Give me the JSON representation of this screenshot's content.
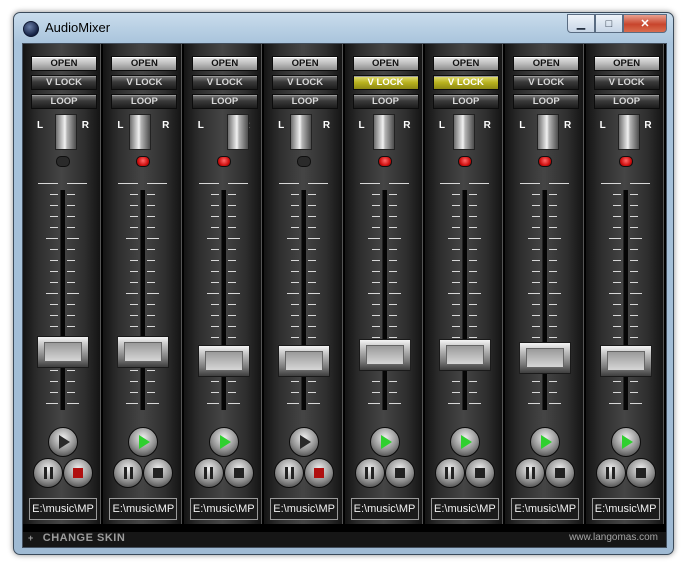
{
  "window": {
    "title": "AudioMixer",
    "minimize_glyph": "▁",
    "maximize_glyph": "□",
    "close_glyph": "✕"
  },
  "pan_labels": {
    "left": "L",
    "right": "R"
  },
  "channels": [
    {
      "open": "OPEN",
      "vlock": "V LOCK",
      "loop": "LOOP",
      "vlock_on": false,
      "pan_pos": 0.55,
      "led_on": false,
      "fader_level": 0.15,
      "playing": false,
      "stopped": true,
      "path": "E:\\music\\MP"
    },
    {
      "open": "OPEN",
      "vlock": "V LOCK",
      "loop": "LOOP",
      "vlock_on": false,
      "pan_pos": 0.38,
      "led_on": true,
      "fader_level": 0.15,
      "playing": true,
      "stopped": false,
      "path": "E:\\music\\MP"
    },
    {
      "open": "OPEN",
      "vlock": "V LOCK",
      "loop": "LOOP",
      "vlock_on": false,
      "pan_pos": 0.9,
      "led_on": true,
      "fader_level": 0.0,
      "playing": true,
      "stopped": false,
      "path": "E:\\music\\MP"
    },
    {
      "open": "OPEN",
      "vlock": "V LOCK",
      "loop": "LOOP",
      "vlock_on": false,
      "pan_pos": 0.38,
      "led_on": false,
      "fader_level": 0.0,
      "playing": false,
      "stopped": true,
      "path": "E:\\music\\MP"
    },
    {
      "open": "OPEN",
      "vlock": "V LOCK",
      "loop": "LOOP",
      "vlock_on": true,
      "pan_pos": 0.45,
      "led_on": true,
      "fader_level": 0.1,
      "playing": true,
      "stopped": false,
      "path": "E:\\music\\MP"
    },
    {
      "open": "OPEN",
      "vlock": "V LOCK",
      "loop": "LOOP",
      "vlock_on": true,
      "pan_pos": 0.45,
      "led_on": true,
      "fader_level": 0.1,
      "playing": true,
      "stopped": false,
      "path": "E:\\music\\MP"
    },
    {
      "open": "OPEN",
      "vlock": "V LOCK",
      "loop": "LOOP",
      "vlock_on": false,
      "pan_pos": 0.55,
      "led_on": true,
      "fader_level": 0.05,
      "playing": true,
      "stopped": false,
      "path": "E:\\music\\MP"
    },
    {
      "open": "OPEN",
      "vlock": "V LOCK",
      "loop": "LOOP",
      "vlock_on": false,
      "pan_pos": 0.55,
      "led_on": true,
      "fader_level": 0.0,
      "playing": true,
      "stopped": false,
      "path": "E:\\music\\MP"
    }
  ],
  "bottom": {
    "plus": "+",
    "change_skin": "CHANGE SKIN",
    "website": "www.langomas.com"
  },
  "colors": {
    "vlock_active": "#b8b21e",
    "led_on": "#d01010",
    "play_active": "#2fd02f",
    "stop_active": "#b01010"
  }
}
